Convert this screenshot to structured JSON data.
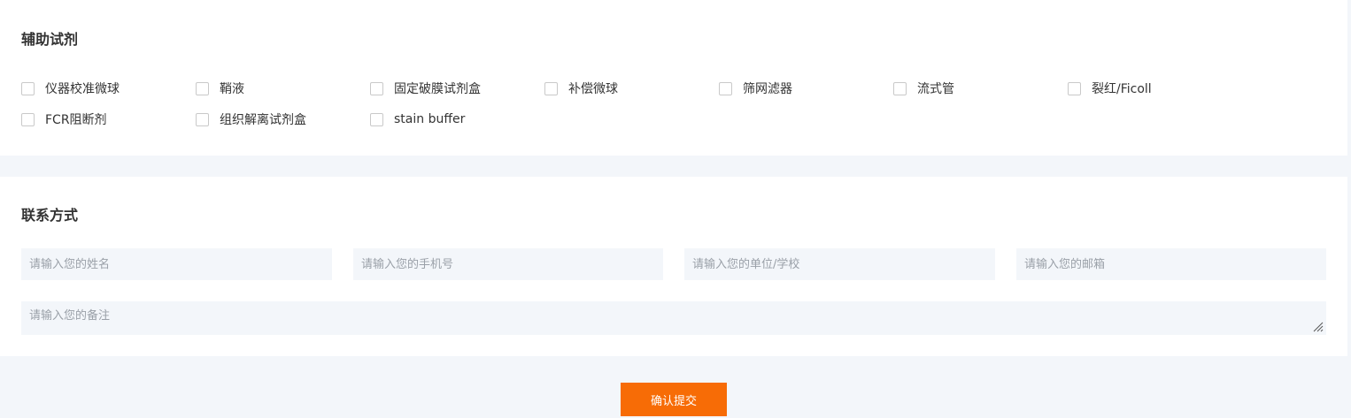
{
  "reagents": {
    "title": "辅助试剂",
    "options": [
      "仪器校准微球",
      "鞘液",
      "固定破膜试剂盒",
      "补偿微球",
      "筛网滤器",
      "流式管",
      "裂红/Ficoll",
      "FCR阻断剂",
      "组织解离试剂盒",
      "stain buffer"
    ],
    "checked": [
      false,
      false,
      false,
      false,
      false,
      false,
      false,
      false,
      false,
      false
    ]
  },
  "contact": {
    "title": "联系方式",
    "name_placeholder": "请输入您的姓名",
    "phone_placeholder": "请输入您的手机号",
    "organization_placeholder": "请输入您的单位/学校",
    "email_placeholder": "请输入您的邮箱",
    "notes_placeholder": "请输入您的备注"
  },
  "submit_label": "确认提交"
}
